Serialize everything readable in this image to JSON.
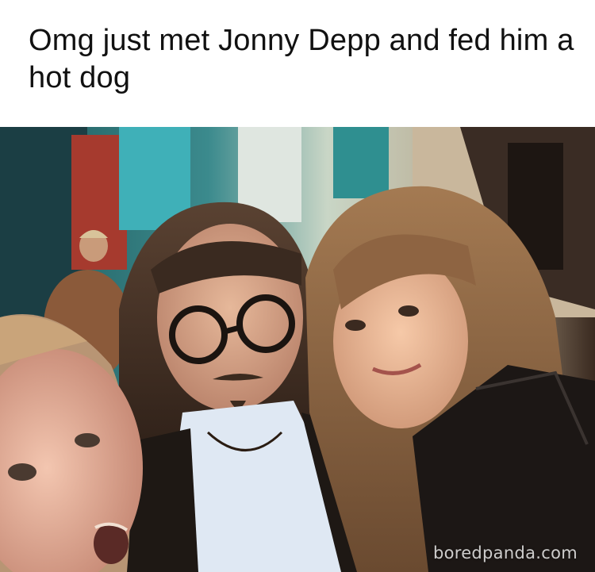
{
  "caption": "Omg just met Jonny Depp and fed him a hot dog",
  "photo": {
    "description_icon": "selfie-photo",
    "watermark": "boredpanda.com"
  }
}
